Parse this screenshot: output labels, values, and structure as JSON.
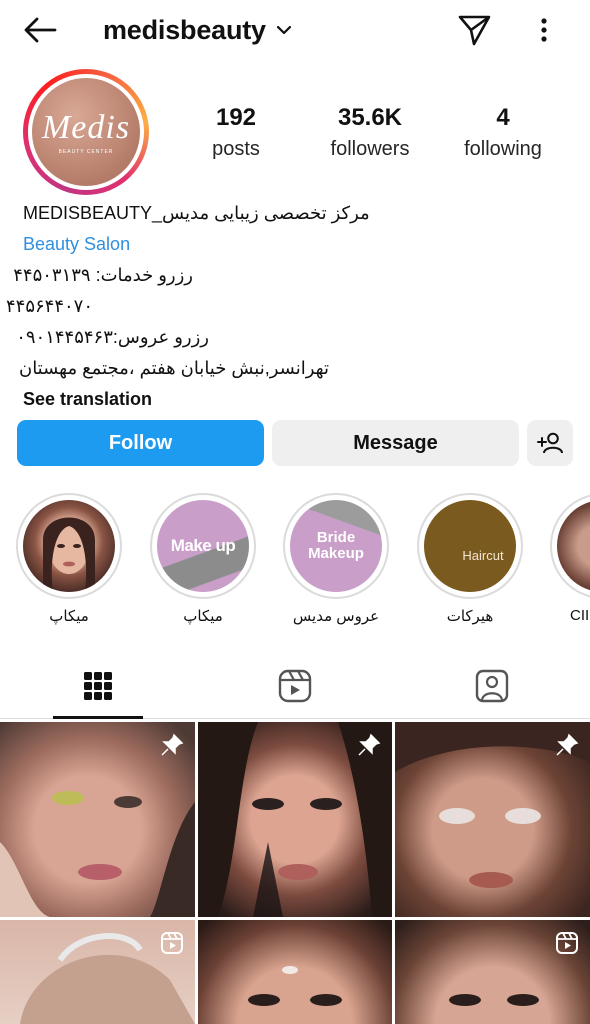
{
  "header": {
    "username": "medisbeauty"
  },
  "profile": {
    "avatar_logo": "Medis",
    "avatar_logo_sub": "BEAUTY CENTER",
    "stats": [
      {
        "value": "192",
        "label": "posts"
      },
      {
        "value": "35.6K",
        "label": "followers"
      },
      {
        "value": "4",
        "label": "following"
      }
    ]
  },
  "bio": {
    "name": "MEDISBEAUTY_مرکز تخصصی زیبایی مدیس",
    "category": "Beauty Salon",
    "lines": [
      "رزرو خدمات: ۴۴۵۰۳۱۳۹",
      "۴۴۵۶۴۴۰۷۰",
      "رزرو عروس:۰۹۰۱۴۴۵۴۶۳",
      "تهرانسر,نبش خیابان هفتم ،مجتمع مهستان"
    ],
    "see_translation": "See translation"
  },
  "actions": {
    "follow": "Follow",
    "message": "Message"
  },
  "highlights": [
    {
      "label": "میکاپ",
      "text": ""
    },
    {
      "label": "میکاپ",
      "text": "Make up"
    },
    {
      "label": "عروس مدیس",
      "text": "Bride Makeup"
    },
    {
      "label": "هیرکات",
      "text": "Haircut"
    },
    {
      "label": "CII",
      "text": ""
    }
  ],
  "tabs": [
    "grid-icon",
    "reels-icon",
    "tagged-icon"
  ],
  "posts": [
    {
      "badge": "pin-icon"
    },
    {
      "badge": "pin-icon"
    },
    {
      "badge": "pin-icon"
    },
    {
      "badge": "reel-icon"
    },
    {
      "badge": ""
    },
    {
      "badge": "reel-icon"
    }
  ],
  "colors": {
    "accent": "#1d9bf0",
    "link": "#2f8fe0",
    "secondary_button": "#efefef"
  }
}
